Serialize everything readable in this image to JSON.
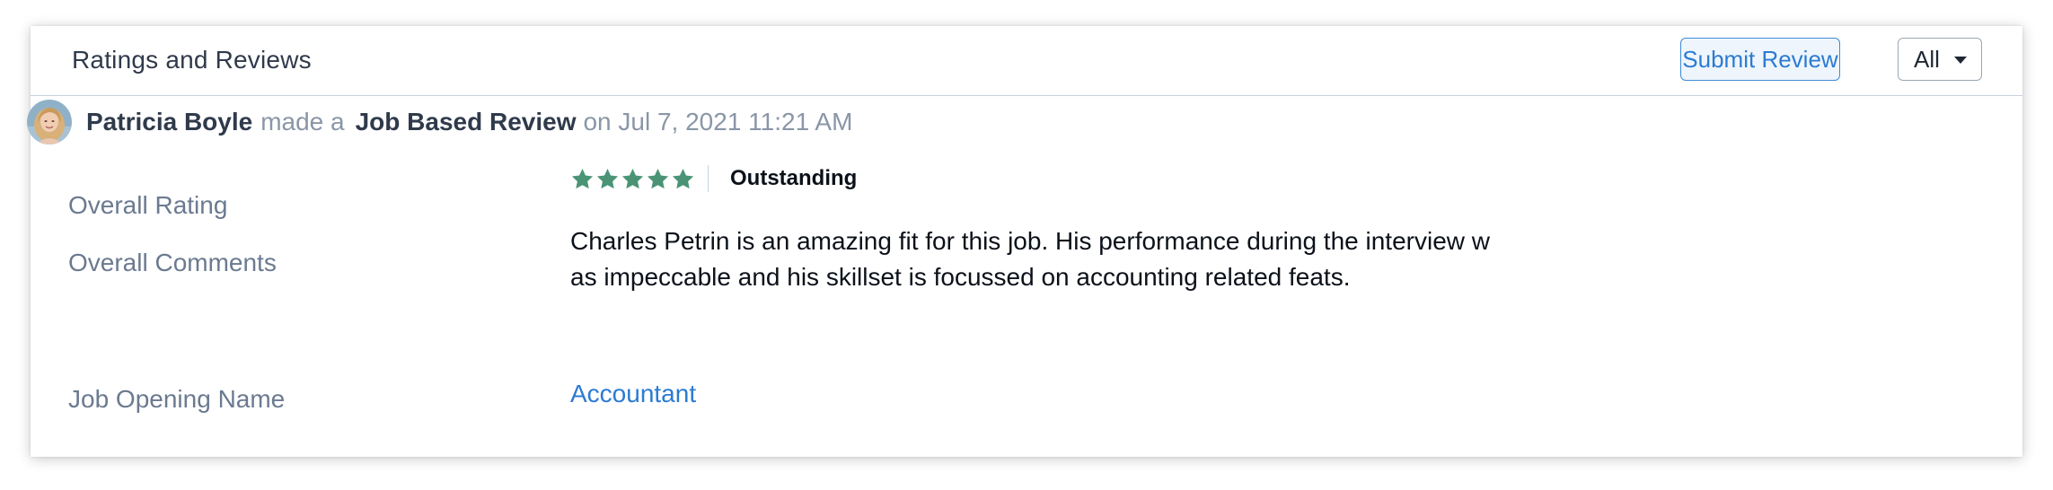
{
  "header": {
    "title": "Ratings and Reviews",
    "submit_label": "Submit Review",
    "filter_value": "All"
  },
  "review": {
    "reviewer": "Patricia Boyle",
    "made_a": "made a",
    "type": "Job Based Review",
    "timestamp": "on Jul 7, 2021 11:21 AM",
    "fields": {
      "overall_rating_label": "Overall Rating",
      "stars": 5,
      "star_color": "#4a9475",
      "rating_text": "Outstanding",
      "overall_comments_label": "Overall Comments",
      "overall_comments": "Charles Petrin is an amazing fit for this job. His performance during the interview was impeccable and his skillset is focussed on accounting related feats.",
      "job_opening_label": "Job Opening Name",
      "job_opening_value": "Accountant"
    }
  },
  "colors": {
    "accent": "#2c7bd1",
    "title_text": "#2f3a4b",
    "label_text": "#6b7a90"
  }
}
